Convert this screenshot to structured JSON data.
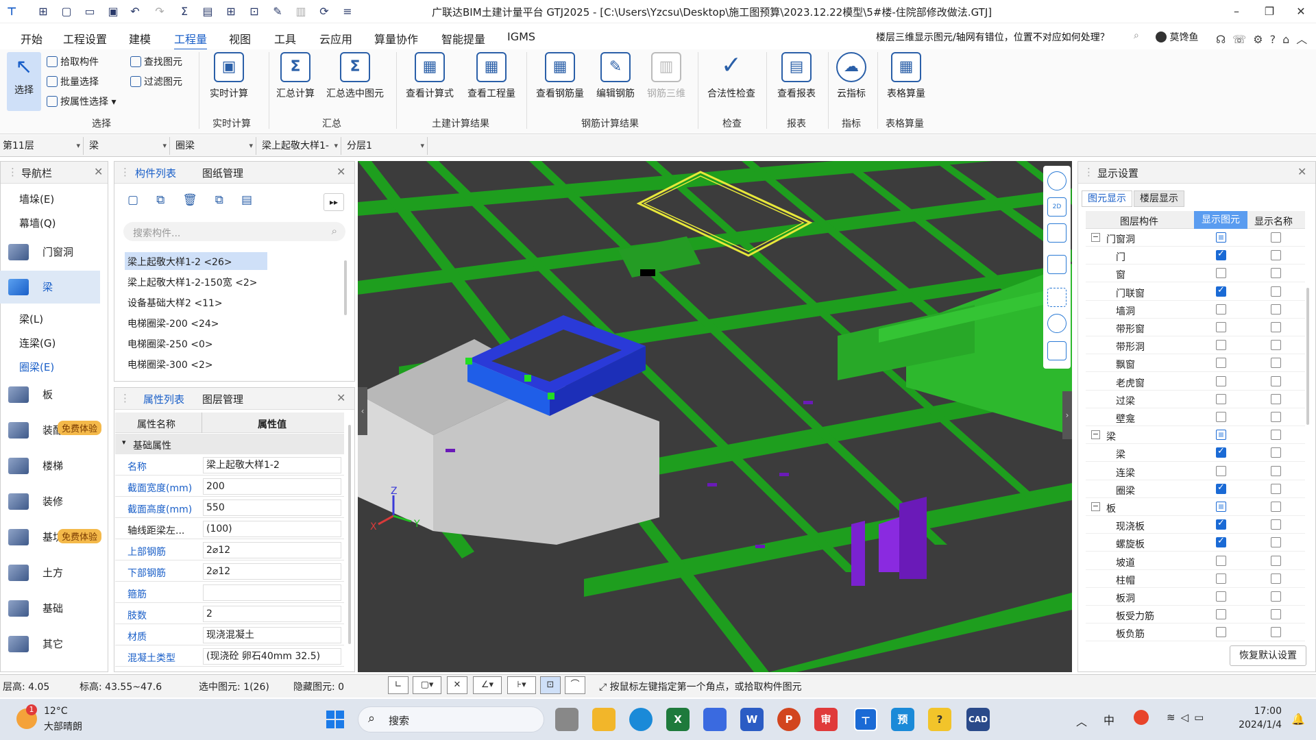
{
  "title": "广联达BIM土建计量平台 GTJ2025 - [C:\\Users\\Yzcsu\\Desktop\\施工图预算\\2023.12.22模型\\5#楼-住院部修改做法.GTJ]",
  "window_controls": {
    "minimize": "–",
    "restore": "❐",
    "close": "✕"
  },
  "menu": [
    "开始",
    "工程设置",
    "建模",
    "工程量",
    "视图",
    "工具",
    "云应用",
    "算量协作",
    "智能提量",
    "IGMS"
  ],
  "menu_active_index": 3,
  "help_search": "楼层三维显示图元/轴网有错位，位置不对应如何处理？",
  "user_name": "莫馋鱼",
  "ribbon": {
    "select_group": {
      "big": "选择",
      "small": [
        "拾取构件",
        "批量选择",
        "按属性选择",
        "查找图元",
        "过滤图元"
      ],
      "label": "选择"
    },
    "groups": [
      {
        "label": "实时计算",
        "buttons": [
          "实时计算"
        ]
      },
      {
        "label": "汇总",
        "buttons": [
          "汇总计算",
          "汇总选中图元"
        ]
      },
      {
        "label": "土建计算结果",
        "buttons": [
          "查看计算式",
          "查看工程量"
        ]
      },
      {
        "label": "钢筋计算结果",
        "buttons": [
          "查看钢筋量",
          "编辑钢筋",
          "钢筋三维"
        ]
      },
      {
        "label": "检查",
        "buttons": [
          "合法性检查"
        ]
      },
      {
        "label": "报表",
        "buttons": [
          "查看报表"
        ]
      },
      {
        "label": "指标",
        "buttons": [
          "云指标"
        ]
      },
      {
        "label": "表格算量",
        "buttons": [
          "表格算量"
        ]
      }
    ]
  },
  "combos": [
    "第11层",
    "梁",
    "圈梁",
    "梁上起敬大样1-",
    "分层1"
  ],
  "nav": {
    "title": "导航栏",
    "items_top": [
      "墙垛(E)",
      "幕墙(Q)"
    ],
    "group_door": "门窗洞",
    "group_beam": "梁",
    "sub_beam": [
      "梁(L)",
      "连梁(G)",
      "圈梁(E)"
    ],
    "groups_rest": [
      "板",
      "装配式",
      "楼梯",
      "装修",
      "基坑",
      "土方",
      "基础",
      "其它"
    ],
    "badge": "免费体验"
  },
  "component_list": {
    "tab_active": "构件列表",
    "tab_other": "图纸管理",
    "search_placeholder": "搜索构件...",
    "items": [
      "梁上起敬大样1-2 <26>",
      "梁上起敬大样1-2-150宽 <2>",
      "设备基础大样2 <11>",
      "电梯圈梁-200 <24>",
      "电梯圈梁-250 <0>",
      "电梯圈梁-300 <2>"
    ]
  },
  "property_list": {
    "tab_active": "属性列表",
    "tab_other": "图层管理",
    "col_name": "属性名称",
    "col_value": "属性值",
    "section": "基础属性",
    "rows": [
      {
        "name": "名称",
        "value": "梁上起敬大样1-2",
        "blue": true
      },
      {
        "name": "截面宽度(mm)",
        "value": "200",
        "blue": true
      },
      {
        "name": "截面高度(mm)",
        "value": "550",
        "blue": true
      },
      {
        "name": "轴线距梁左...",
        "value": "(100)",
        "blue": false
      },
      {
        "name": "上部钢筋",
        "value": "2⌀12",
        "blue": true
      },
      {
        "name": "下部钢筋",
        "value": "2⌀12",
        "blue": true
      },
      {
        "name": "箍筋",
        "value": "",
        "blue": true
      },
      {
        "name": "肢数",
        "value": "2",
        "blue": true
      },
      {
        "name": "材质",
        "value": "现浇混凝土",
        "blue": true
      },
      {
        "name": "混凝土类型",
        "value": "(现浇砼 卵石40mm 32.5)",
        "blue": true
      }
    ]
  },
  "display_settings": {
    "title": "显示设置",
    "tab_active": "图元显示",
    "tab_other": "楼层显示",
    "col_layer": "图层构件",
    "col_show": "显示图元",
    "col_name": "显示名称",
    "rows": [
      {
        "label": "门窗洞",
        "group": true,
        "show": "part",
        "name": false
      },
      {
        "label": "门",
        "group": false,
        "show": "on",
        "name": false
      },
      {
        "label": "窗",
        "group": false,
        "show": "off",
        "name": false
      },
      {
        "label": "门联窗",
        "group": false,
        "show": "on",
        "name": false
      },
      {
        "label": "墙洞",
        "group": false,
        "show": "off",
        "name": false
      },
      {
        "label": "带形窗",
        "group": false,
        "show": "off",
        "name": false
      },
      {
        "label": "带形洞",
        "group": false,
        "show": "off",
        "name": false
      },
      {
        "label": "飘窗",
        "group": false,
        "show": "off",
        "name": false
      },
      {
        "label": "老虎窗",
        "group": false,
        "show": "off",
        "name": false
      },
      {
        "label": "过梁",
        "group": false,
        "show": "off",
        "name": false
      },
      {
        "label": "壁龛",
        "group": false,
        "show": "off",
        "name": false
      },
      {
        "label": "梁",
        "group": true,
        "show": "part",
        "name": false
      },
      {
        "label": "梁",
        "group": false,
        "show": "on",
        "name": false
      },
      {
        "label": "连梁",
        "group": false,
        "show": "off",
        "name": false
      },
      {
        "label": "圈梁",
        "group": false,
        "show": "on",
        "name": false
      },
      {
        "label": "板",
        "group": true,
        "show": "part",
        "name": false
      },
      {
        "label": "现浇板",
        "group": false,
        "show": "on",
        "name": false
      },
      {
        "label": "螺旋板",
        "group": false,
        "show": "on",
        "name": false
      },
      {
        "label": "坡道",
        "group": false,
        "show": "off",
        "name": false
      },
      {
        "label": "柱帽",
        "group": false,
        "show": "off",
        "name": false
      },
      {
        "label": "板洞",
        "group": false,
        "show": "off",
        "name": false
      },
      {
        "label": "板受力筋",
        "group": false,
        "show": "off",
        "name": false
      },
      {
        "label": "板负筋",
        "group": false,
        "show": "off",
        "name": false
      }
    ],
    "restore_button": "恢复默认设置"
  },
  "statusbar": {
    "floor_height": "层高:  4.05",
    "elevation": "标高:  43.55~47.6",
    "selected": "选中图元:  1(26)",
    "hidden": "隐藏图元:  0",
    "hint": "按鼠标左键指定第一个角点，或拾取构件图元"
  },
  "axis_labels": {
    "z": "Z",
    "x": "X",
    "y": "Y"
  },
  "taskbar": {
    "weather_temp": "12°C",
    "weather_desc": "大部晴朗",
    "weather_badge": "1",
    "search_placeholder": "搜索",
    "ime": "中",
    "time": "17:00",
    "date": "2024/1/4",
    "apps": [
      "审",
      "预",
      "CAD"
    ]
  },
  "colors": {
    "accent": "#1a5fc8",
    "beam_green": "#1e9e1e",
    "selection_blue": "#2a3ad8",
    "highlight_yellow": "#e8e83a",
    "badge_orange": "#f4b94a"
  }
}
